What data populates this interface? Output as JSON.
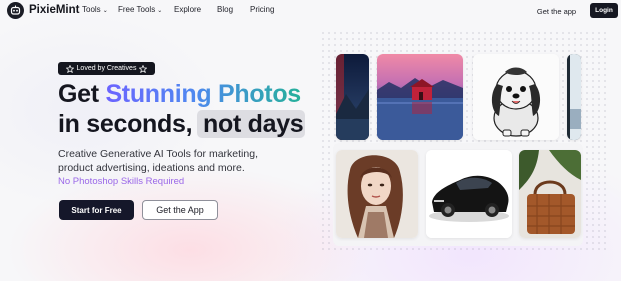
{
  "brand": {
    "name": "PixieMint",
    "logo_icon": "robot-face-icon"
  },
  "nav": {
    "items": [
      {
        "label": "Tools",
        "has_dropdown": true
      },
      {
        "label": "Free Tools",
        "has_dropdown": true
      },
      {
        "label": "Explore",
        "has_dropdown": false
      },
      {
        "label": "Blog",
        "has_dropdown": false
      },
      {
        "label": "Pricing",
        "has_dropdown": false
      }
    ],
    "get_app_label": "Get the app",
    "login_label": "Login"
  },
  "hero": {
    "badge": "Loved by Creatives",
    "headline_word1": "Get",
    "headline_accent": "Stunning Photos",
    "headline_line2": "in seconds,",
    "headline_highlight": "not days",
    "subtitle_line1": "Creative Generative AI Tools for marketing,",
    "subtitle_line2": "product advertising, ideations and more.",
    "tagline": "No Photoshop Skills Required",
    "primary_cta": "Start for Free",
    "secondary_cta": "Get the App"
  },
  "gallery": {
    "images": [
      "night-landscape-image",
      "red-cabin-lake-image",
      "shih-tzu-sketch-image",
      "partial-snow-image",
      "woman-portrait-sketch-image",
      "black-sports-car-image",
      "leather-handbag-image"
    ]
  },
  "colors": {
    "accent_start": "#6c63ff",
    "accent_end": "#25b09a",
    "tagline": "#9a67e8",
    "dark": "#15172a"
  }
}
